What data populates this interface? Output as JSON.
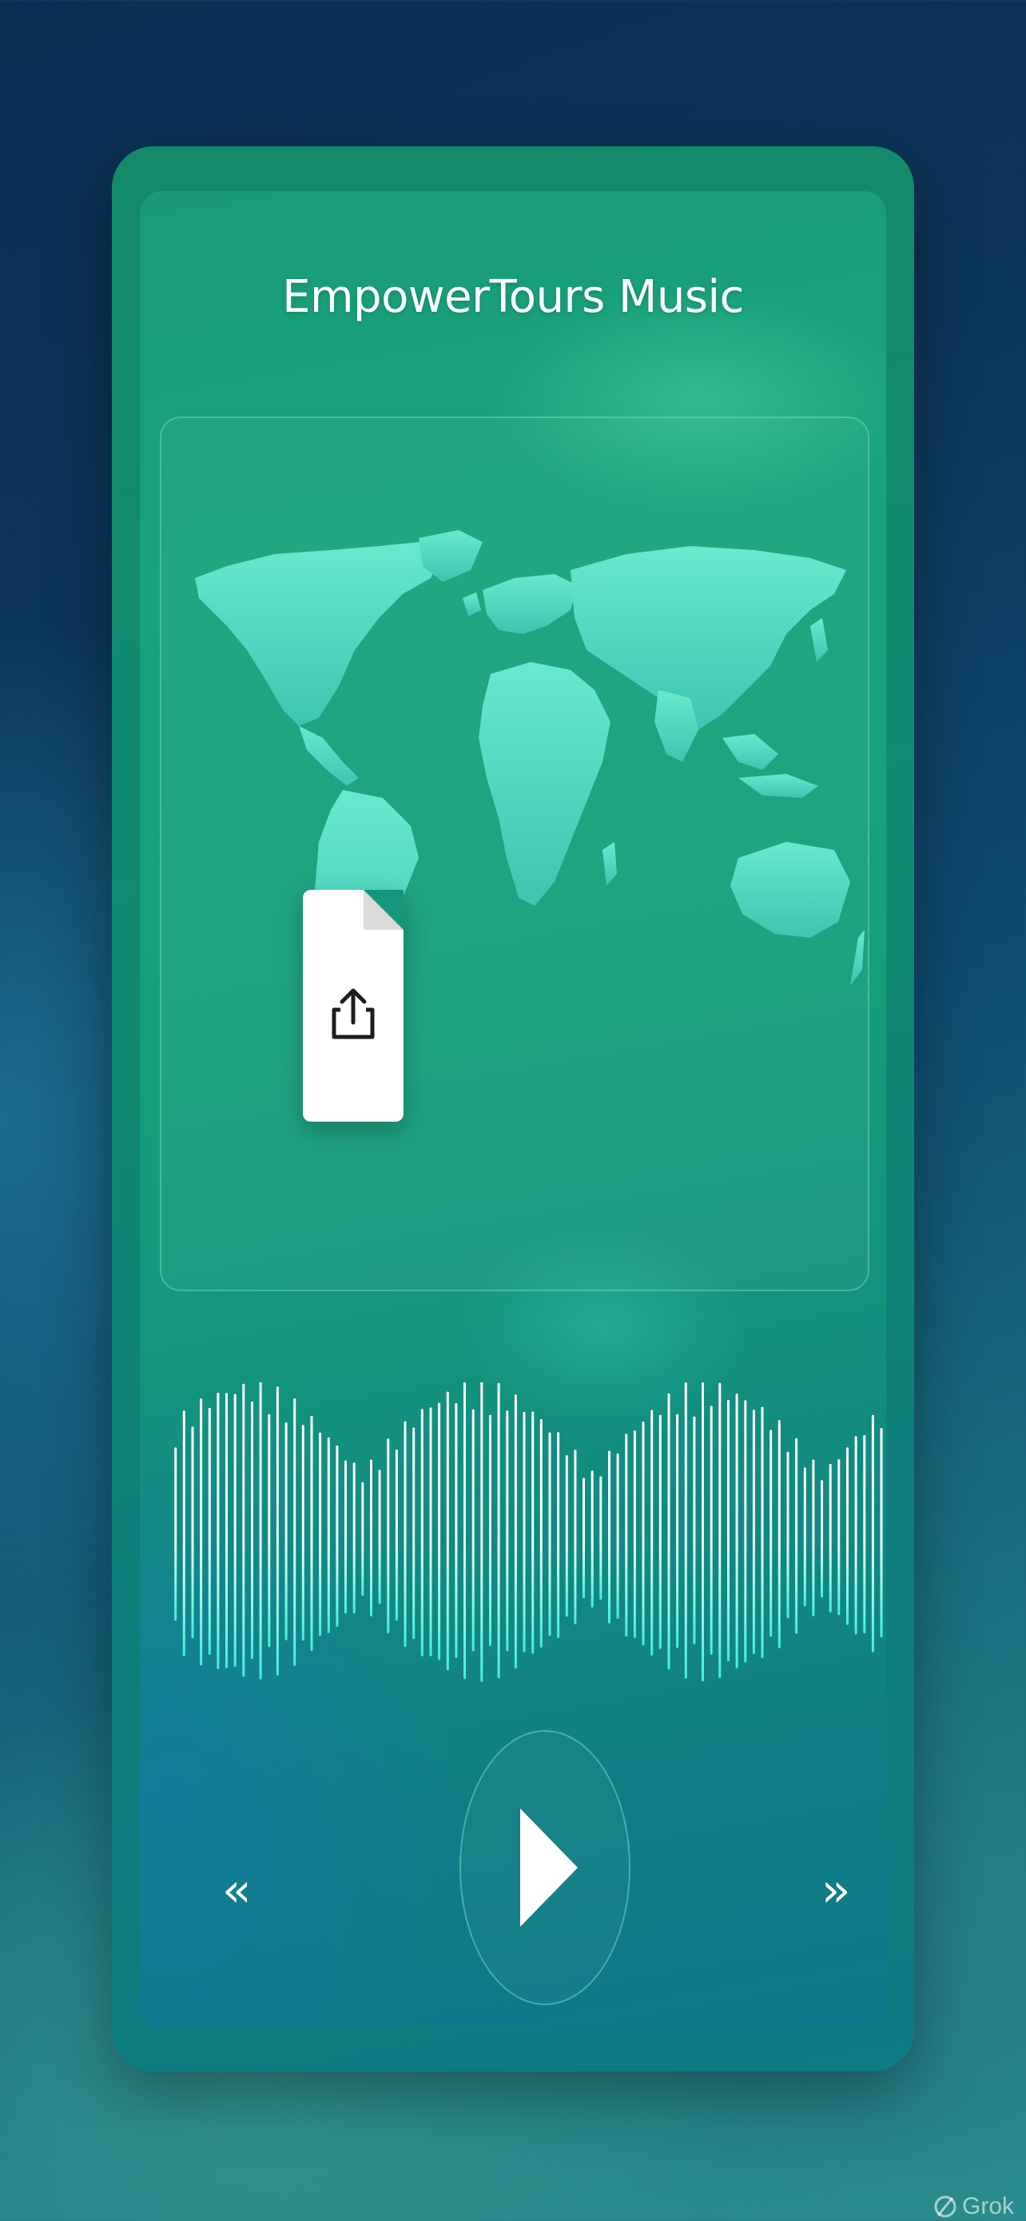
{
  "app": {
    "title": "EmpowerTours Music"
  },
  "map": {
    "icon": "world-map"
  },
  "share": {
    "icon": "share-icon"
  },
  "player": {
    "play_icon": "play-icon",
    "prev_label": "‹‹",
    "next_label": "››"
  },
  "watermark": {
    "label": "Grok"
  },
  "colors": {
    "accent": "#5ff0d8",
    "continent": "#4fe0c8",
    "wave": "#ffffff"
  }
}
